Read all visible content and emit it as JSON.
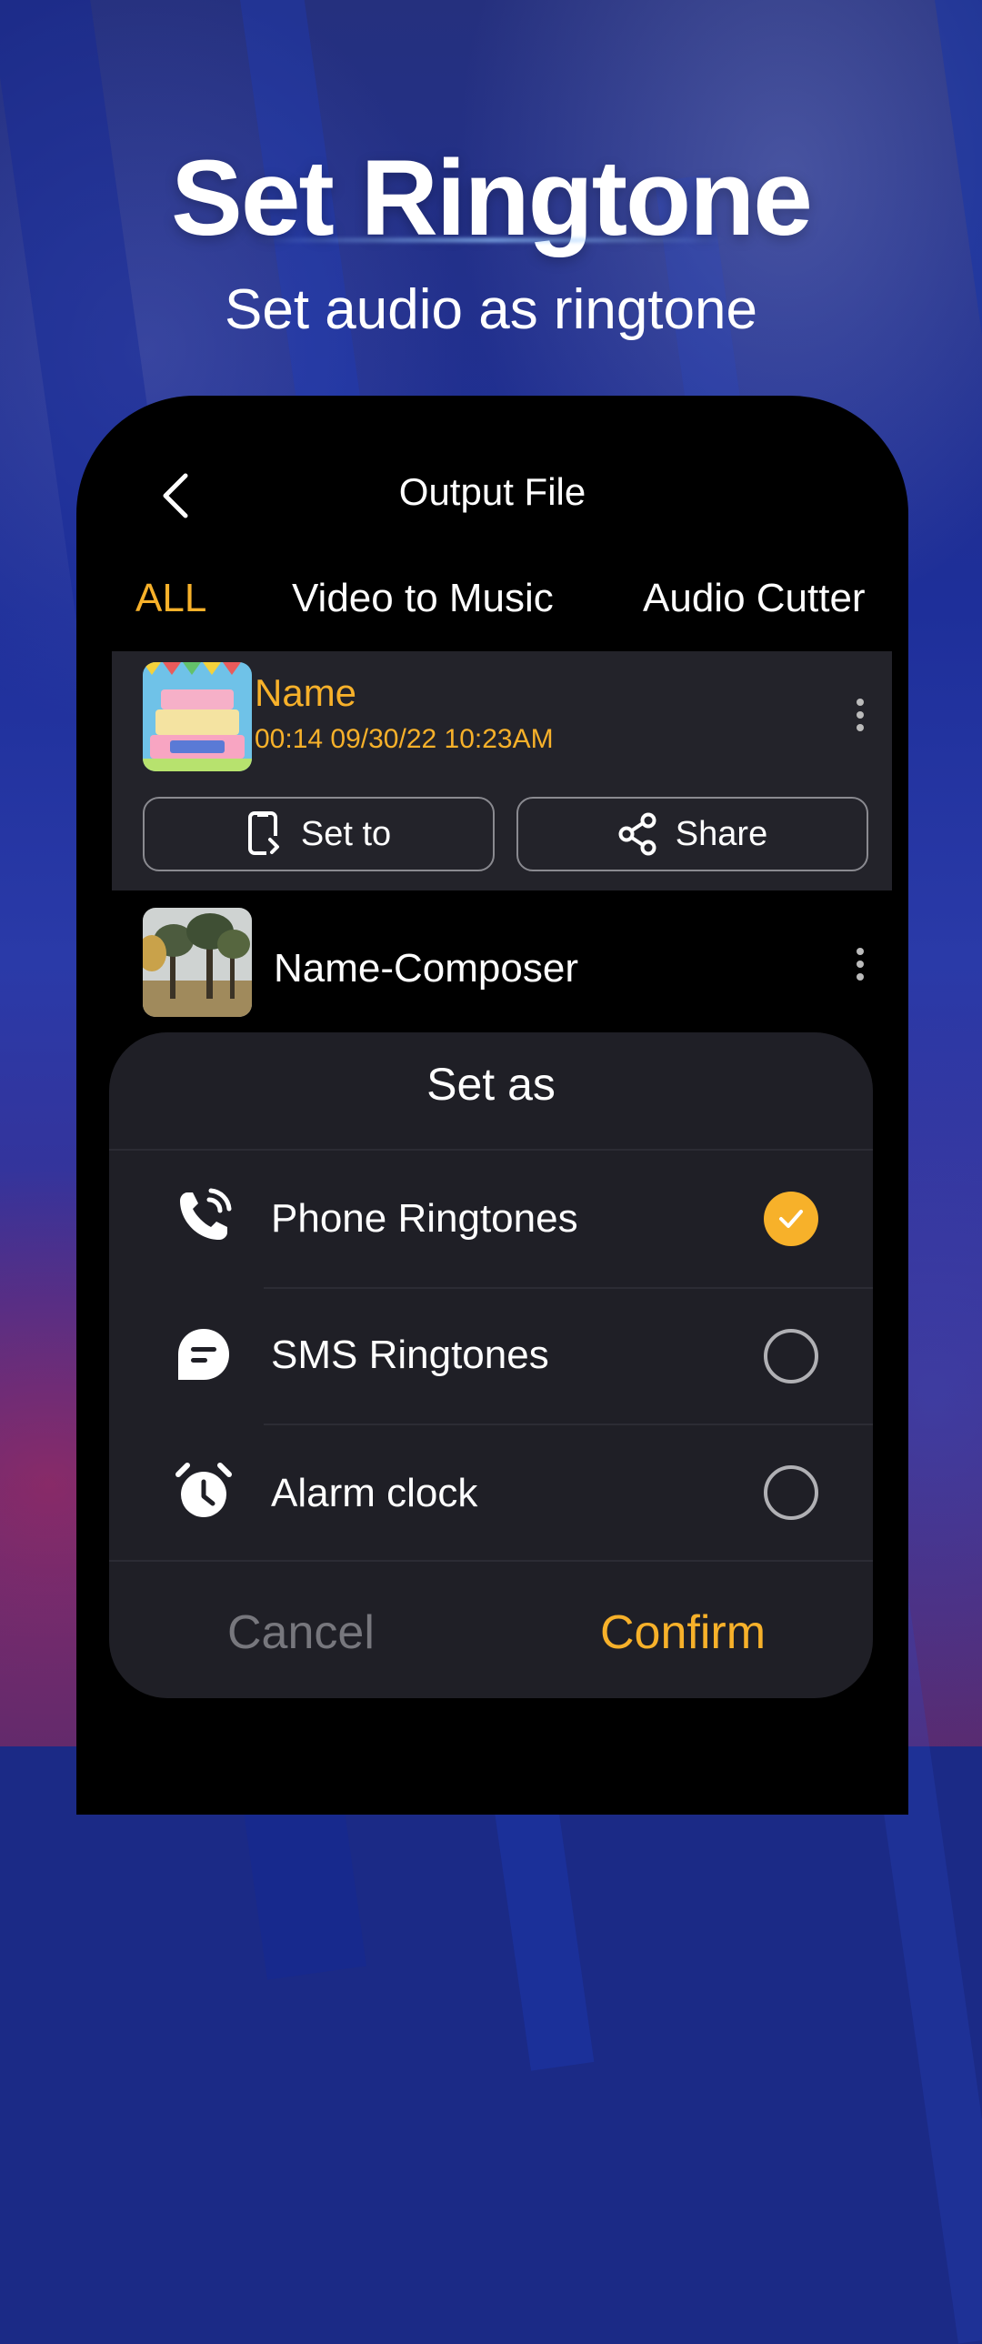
{
  "hero": {
    "title": "Set Ringtone",
    "subtitle": "Set audio as ringtone"
  },
  "screen": {
    "title": "Output File",
    "back_icon": "chevron-left-icon"
  },
  "tabs": [
    {
      "label": "ALL",
      "active": true
    },
    {
      "label": "Video to Music",
      "active": false
    },
    {
      "label": "Audio Cutter",
      "active": false
    }
  ],
  "files": [
    {
      "name": "Name",
      "meta": "00:14 09/30/22 10:23AM",
      "thumbnail": "birthday-cake-thumbnail",
      "selected": true,
      "actions": {
        "set_to": "Set to",
        "share": "Share"
      }
    },
    {
      "name": "Name-Composer",
      "thumbnail": "trees-thumbnail",
      "selected": false
    }
  ],
  "sheet": {
    "title": "Set as",
    "options": [
      {
        "label": "Phone Ringtones",
        "icon": "phone-ring-icon",
        "checked": true
      },
      {
        "label": "SMS Ringtones",
        "icon": "message-icon",
        "checked": false
      },
      {
        "label": "Alarm clock",
        "icon": "alarm-clock-icon",
        "checked": false
      }
    ],
    "cancel": "Cancel",
    "confirm": "Confirm"
  },
  "colors": {
    "accent": "#f7b12a",
    "phone_bg": "#000000",
    "sheet_bg": "#1f1f26",
    "selected_row_bg": "#23232a"
  }
}
